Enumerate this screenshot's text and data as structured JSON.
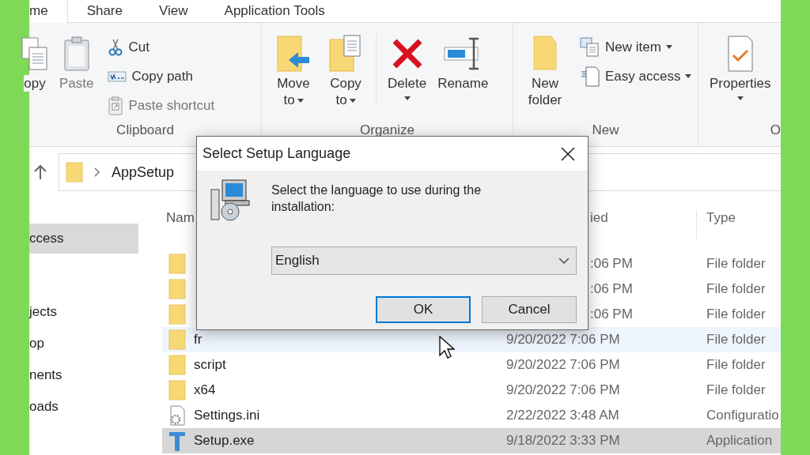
{
  "tabs": [
    {
      "label": "me",
      "selected": true
    },
    {
      "label": "Share",
      "selected": false
    },
    {
      "label": "View",
      "selected": false
    },
    {
      "label": "Application Tools",
      "selected": false
    }
  ],
  "ribbon": {
    "clipboard": {
      "label": "Clipboard",
      "copy": {
        "label": "opy",
        "disabled": false
      },
      "paste": {
        "label": "Paste",
        "disabled": true
      },
      "cut": {
        "label": "Cut",
        "disabled": false
      },
      "copy_path": {
        "label": "Copy path",
        "disabled": false
      },
      "paste_shortcut": {
        "label": "Paste shortcut",
        "disabled": true
      }
    },
    "organize": {
      "label": "Organize",
      "move_to": "Move to",
      "copy_to": "Copy to",
      "delete": "Delete",
      "rename": "Rename"
    },
    "new": {
      "label": "New",
      "new_folder": "New folder",
      "new_item": "New item",
      "easy_access": "Easy access"
    },
    "open": {
      "label": "O",
      "properties": "Properties"
    }
  },
  "address": {
    "path": "AppSetup"
  },
  "nav": [
    {
      "label": "ccess",
      "selected": true
    },
    {
      "label": "jects",
      "selected": false
    },
    {
      "label": "op",
      "selected": false
    },
    {
      "label": "nents",
      "selected": false
    },
    {
      "label": "oads",
      "selected": false
    }
  ],
  "files": {
    "columns": [
      {
        "label": "Nam",
        "covered": false
      },
      {
        "label": "ied",
        "covered": true
      },
      {
        "label": "Type",
        "covered": false
      }
    ],
    "rows": [
      {
        "kind": "folder",
        "covered": true,
        "modified": ":06 PM",
        "type": "File folder",
        "selected": false,
        "hovered": false
      },
      {
        "kind": "folder",
        "covered": true,
        "modified": ":06 PM",
        "type": "File folder",
        "selected": false,
        "hovered": false
      },
      {
        "kind": "folder",
        "covered": true,
        "modified": ":06 PM",
        "type": "File folder",
        "selected": false,
        "hovered": false
      },
      {
        "kind": "folder",
        "covered": false,
        "name": "fr",
        "modified": "9/20/2022 7:06 PM",
        "type": "File folder",
        "selected": false,
        "hovered": true
      },
      {
        "kind": "folder",
        "covered": false,
        "name": "script",
        "modified": "9/20/2022 7:06 PM",
        "type": "File folder",
        "selected": false,
        "hovered": false
      },
      {
        "kind": "folder",
        "covered": false,
        "name": "x64",
        "modified": "9/20/2022 7:06 PM",
        "type": "File folder",
        "selected": false,
        "hovered": false
      },
      {
        "kind": "config",
        "covered": false,
        "name": "Settings.ini",
        "modified": "2/22/2022 3:48 AM",
        "type": "Configuratio",
        "selected": false,
        "hovered": false
      },
      {
        "kind": "app",
        "covered": false,
        "name": "Setup.exe",
        "modified": "9/18/2022 3:33 PM",
        "type": "Application",
        "selected": true,
        "hovered": false
      }
    ]
  },
  "dialog": {
    "title": "Select Setup Language",
    "message": "Select the language to use during the installation:",
    "language": "English",
    "buttons": [
      {
        "label": "OK",
        "focused": true
      },
      {
        "label": "Cancel",
        "focused": false
      }
    ]
  }
}
